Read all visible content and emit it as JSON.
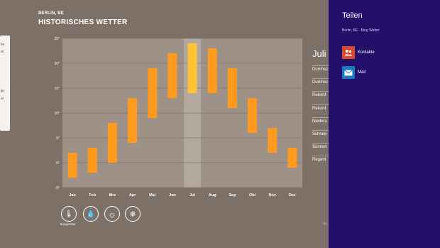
{
  "left_cards": [
    {
      "lines": [
        "ke",
        "al"
      ]
    },
    {
      "lines": [
        "llit",
        "al"
      ]
    }
  ],
  "header": {
    "location": "BERLIN, BE",
    "title": "HISTORISCHES WETTER"
  },
  "chart_data": {
    "type": "bar",
    "subtype": "range",
    "categories": [
      "Jan",
      "Feb",
      "Mrz",
      "Apr",
      "Mai",
      "Jun",
      "Jul",
      "Aug",
      "Sep",
      "Okt",
      "Nov",
      "Dez"
    ],
    "series": [
      {
        "low": [
          -3,
          -2,
          0,
          4,
          9,
          13,
          14,
          14,
          11,
          6,
          2,
          -1
        ],
        "high": [
          2,
          3,
          8,
          13,
          19,
          22,
          24,
          23,
          19,
          13,
          7,
          3
        ]
      }
    ],
    "y_ticks": [
      "25°",
      "20°",
      "15°",
      "10°",
      "5°",
      "0°",
      "-5°"
    ],
    "ylim": [
      -5,
      25
    ],
    "selected": "Jul",
    "bar_color": "#ff9a1f",
    "selected_bar_color": "#ffc338",
    "grid": true
  },
  "details": {
    "month": "Juli",
    "rows": [
      "Durchsc",
      "Durchsc",
      "Rekord",
      "Rekord",
      "Nieders",
      "Schnee",
      "Sonnen",
      "Regent"
    ]
  },
  "weather_icons": [
    {
      "icon": "thermometer-icon",
      "glyph": "🌡"
    },
    {
      "icon": "raindrop-icon",
      "glyph": "💧"
    },
    {
      "icon": "sun-icon",
      "glyph": "☼"
    },
    {
      "icon": "snowflake-icon",
      "glyph": "❄"
    }
  ],
  "temp_label": "Temperatur",
  "footnote": "",
  "right_edge_text": "Su",
  "share": {
    "title": "Teilen",
    "subtitle": "Berlin, BE - Bing Wetter",
    "items": [
      {
        "label": "Kontakte",
        "icon": "people-icon",
        "color": "#d94a2a"
      },
      {
        "label": "Mail",
        "icon": "mail-icon",
        "color": "#1b79c2"
      }
    ]
  }
}
